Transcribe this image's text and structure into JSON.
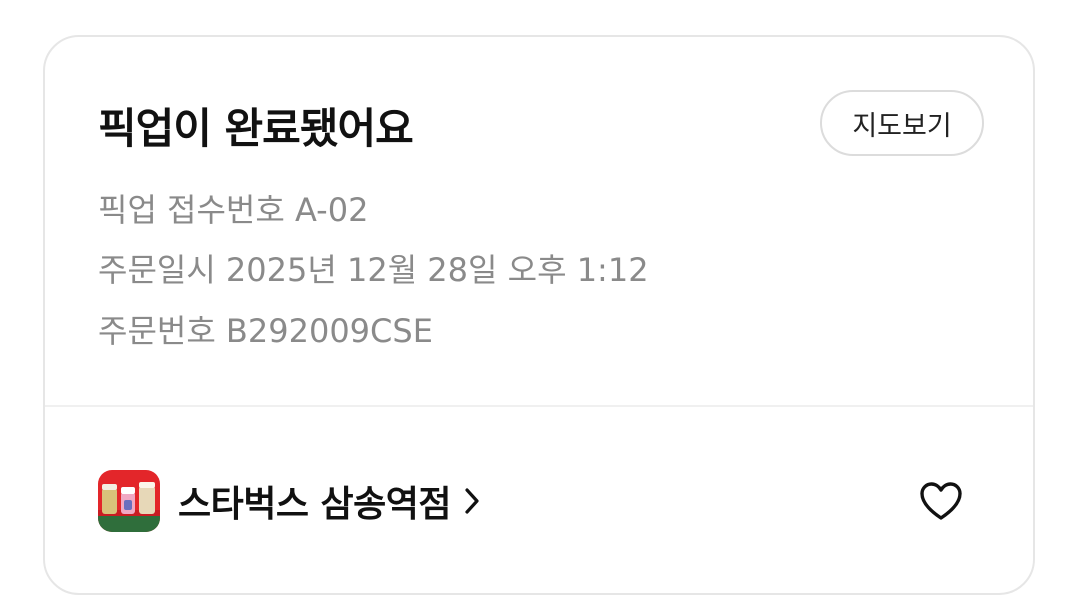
{
  "status": {
    "title": "픽업이 완료됐어요",
    "map_button_label": "지도보기"
  },
  "details": {
    "pickup_number": "픽업 접수번호 A-02",
    "order_datetime": "주문일시 2025년 12월 28일 오후 1:12",
    "order_number": "주문번호 B292009CSE"
  },
  "store": {
    "name": "스타벅스 삼송역점",
    "logo_icon": "store-drinks-logo",
    "chevron_icon": "chevron-right-icon",
    "favorite_icon": "heart-outline-icon"
  },
  "colors": {
    "title": "#111111",
    "secondary_text": "#8a8a8a",
    "card_border": "#e6e6e6",
    "logo_bg": "#e3262a"
  }
}
